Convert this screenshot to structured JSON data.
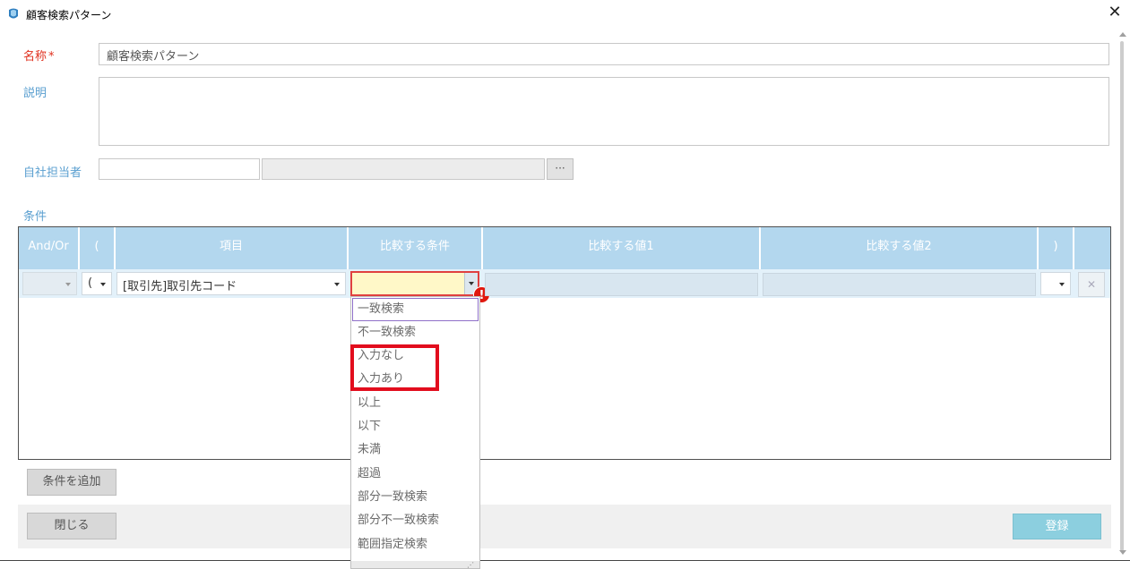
{
  "window": {
    "title": "顧客検索パターン",
    "close_glyph": "✕"
  },
  "form": {
    "name_label": "名称",
    "required_mark": "*",
    "name_value": "顧客検索パターン",
    "description_label": "説明",
    "description_value": "",
    "owner_label": "自社担当者",
    "owner_code": "",
    "owner_name": "",
    "owner_lookup_glyph": "···"
  },
  "conditions": {
    "section_label": "条件",
    "headers": [
      "And/Or",
      "(",
      "項目",
      "比較する条件",
      "比較する値1",
      "比較する値2",
      ")"
    ],
    "row": {
      "and_or": "",
      "open_paren": "(",
      "field": "[取引先]取引先コード",
      "operator": "",
      "value1": "",
      "value2": "",
      "close_paren": "",
      "delete_glyph": "✕"
    },
    "error_mark": "!",
    "operator_options": [
      "一致検索",
      "不一致検索",
      "入力なし",
      "入力あり",
      "以上",
      "以下",
      "未満",
      "超過",
      "部分一致検索",
      "部分不一致検索",
      "範囲指定検索"
    ],
    "selected_option_index": 0,
    "highlighted_options": [
      "入力なし",
      "入力あり"
    ],
    "add_button": "条件を追加"
  },
  "footer": {
    "close_button": "閉じる",
    "register_button": "登録"
  },
  "colors": {
    "header_bg": "#b3d7ee",
    "label": "#5a9fd0",
    "required": "#e0301e",
    "highlight": "#e20d1d",
    "register_bg": "#8ccfdf"
  },
  "icons": {
    "app": "app-logo-icon",
    "close": "close-icon",
    "caret": "caret-down-icon",
    "error": "error-icon"
  }
}
